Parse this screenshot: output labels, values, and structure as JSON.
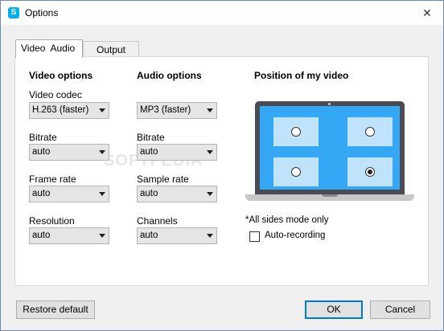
{
  "window": {
    "title": "Options",
    "close_glyph": "✕",
    "app_icon_letter": "S"
  },
  "tabs": [
    {
      "label": "Video  Audio"
    },
    {
      "label": "Output"
    }
  ],
  "video": {
    "title": "Video options",
    "codec_label": "Video codec",
    "codec_value": "H.263 (faster)",
    "bitrate_label": "Bitrate",
    "bitrate_value": "auto",
    "framerate_label": "Frame rate",
    "framerate_value": "auto",
    "resolution_label": "Resolution",
    "resolution_value": "auto"
  },
  "audio": {
    "title": "Audio options",
    "codec_value": "MP3 (faster)",
    "bitrate_label": "Bitrate",
    "bitrate_value": "auto",
    "samplerate_label": "Sample rate",
    "samplerate_value": "auto",
    "channels_label": "Channels",
    "channels_value": "auto"
  },
  "position": {
    "title": "Position of my video",
    "selected": "bottom-right",
    "note": "*All sides mode only",
    "auto_recording_label": "Auto-recording",
    "auto_recording_checked": false
  },
  "buttons": {
    "restore": "Restore default",
    "ok": "OK",
    "cancel": "Cancel"
  },
  "watermark": "SOFTPEDIA",
  "colors": {
    "screen": "#34a7f5",
    "tile": "#bfe3fb",
    "accent": "#0078d7"
  }
}
